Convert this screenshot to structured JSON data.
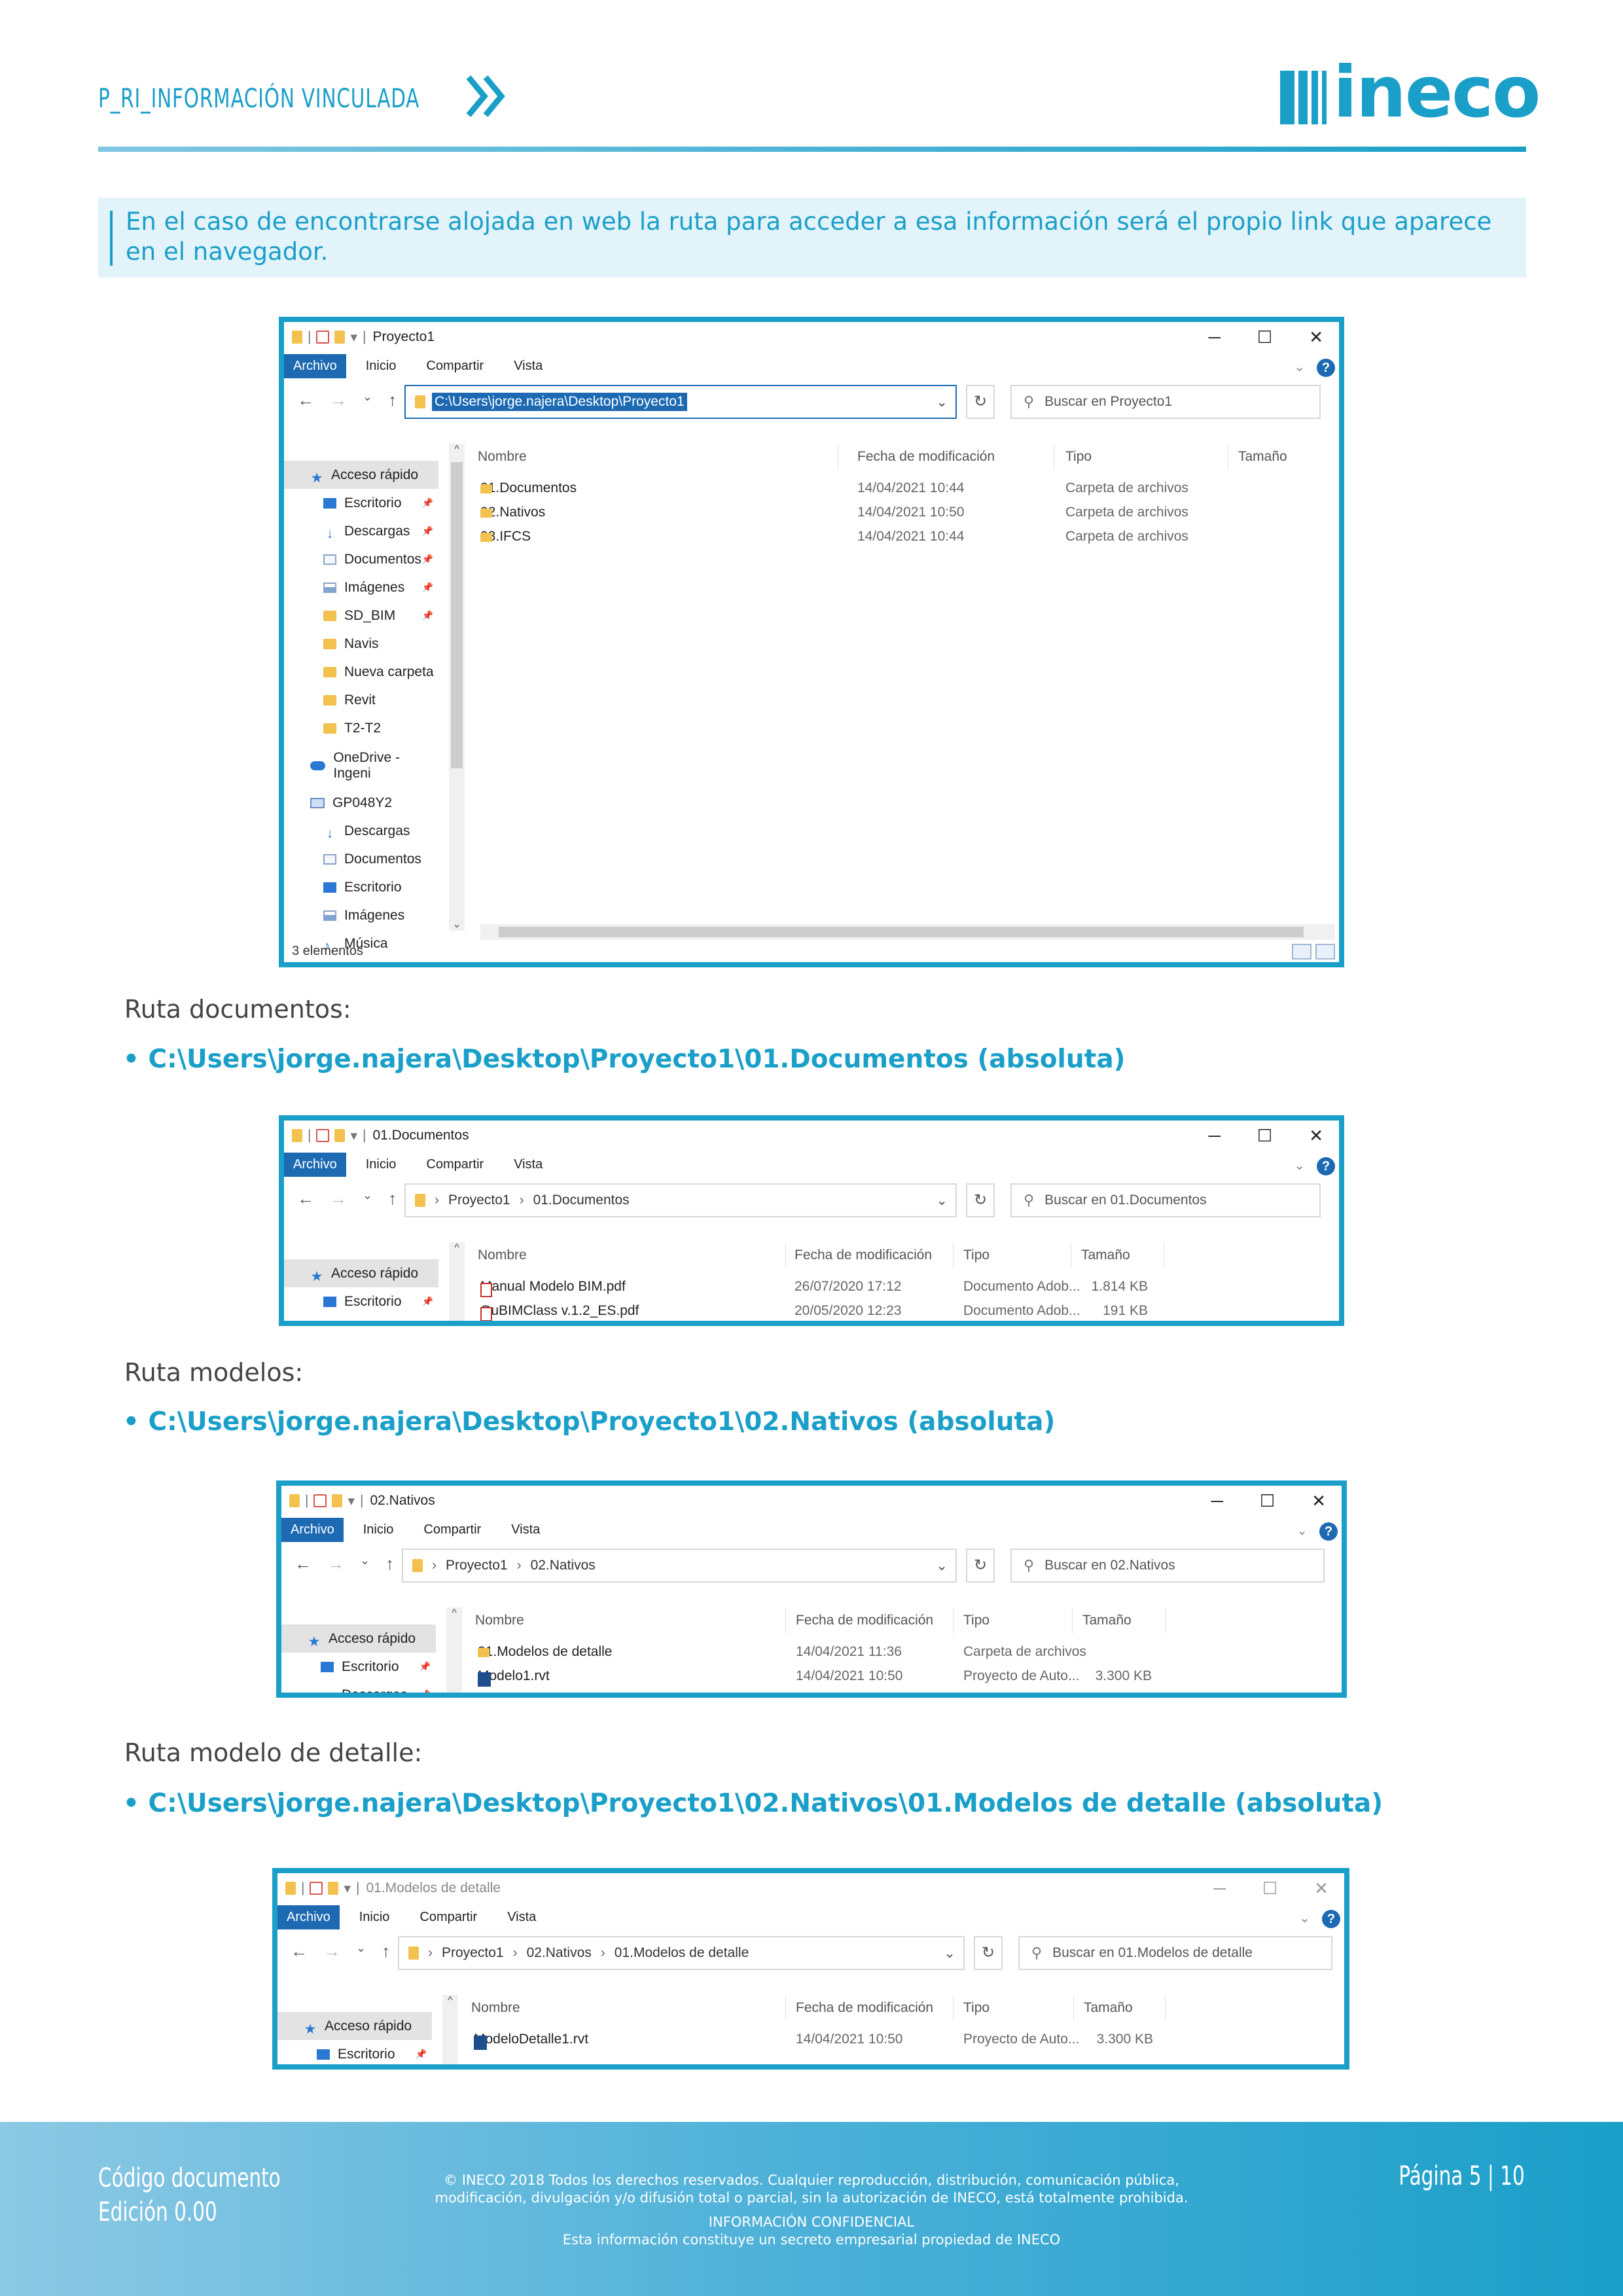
{
  "header": {
    "doc_title": "P_RI_INFORMACIÓN VINCULADA",
    "logo_text": "ineco",
    "brand_color": "#1a9fc9"
  },
  "intro": "En el caso de encontrarse alojada en web la ruta para acceder a esa información será el propio link que aparece en el navegador.",
  "sections": [
    {
      "label": "Ruta documentos:",
      "path": "• C:\\Users\\jorge.najera\\Desktop\\Proyecto1\\01.Documentos (absoluta)"
    },
    {
      "label": "Ruta modelos:",
      "path": "• C:\\Users\\jorge.najera\\Desktop\\Proyecto1\\02.Nativos (absoluta)"
    },
    {
      "label": "Ruta modelo de detalle:",
      "path": "• C:\\Users\\jorge.najera\\Desktop\\Proyecto1\\02.Nativos\\01.Modelos de detalle (absoluta)"
    }
  ],
  "explorer_common": {
    "ribbon": [
      "Archivo",
      "Inicio",
      "Compartir",
      "Vista"
    ],
    "columns": [
      "Nombre",
      "Fecha de modificación",
      "Tipo",
      "Tamaño"
    ],
    "window_controls": [
      "─",
      "☐",
      "✕"
    ],
    "help": "?"
  },
  "win1": {
    "title": "Proyecto1",
    "address": "C:\\Users\\jorge.najera\\Desktop\\Proyecto1",
    "search": "Buscar en Proyecto1",
    "sidebar": [
      {
        "label": "Acceso rápido",
        "icon": "star-icon"
      },
      {
        "label": "Escritorio",
        "icon": "desktop-icon",
        "pinned": true
      },
      {
        "label": "Descargas",
        "icon": "download-icon",
        "pinned": true
      },
      {
        "label": "Documentos",
        "icon": "document-icon",
        "pinned": true
      },
      {
        "label": "Imágenes",
        "icon": "images-icon",
        "pinned": true
      },
      {
        "label": "SD_BIM",
        "icon": "folder-icon",
        "pinned": true
      },
      {
        "label": "Navis",
        "icon": "folder-icon"
      },
      {
        "label": "Nueva carpeta",
        "icon": "folder-icon"
      },
      {
        "label": "Revit",
        "icon": "folder-icon"
      },
      {
        "label": "T2-T2",
        "icon": "folder-icon"
      },
      {
        "label": "OneDrive - Ingeni",
        "icon": "cloud-icon"
      },
      {
        "label": "GP048Y2",
        "icon": "computer-icon"
      },
      {
        "label": "Descargas",
        "icon": "download-icon"
      },
      {
        "label": "Documentos",
        "icon": "document-icon"
      },
      {
        "label": "Escritorio",
        "icon": "desktop-icon"
      },
      {
        "label": "Imágenes",
        "icon": "images-icon"
      },
      {
        "label": "Música",
        "icon": "music-icon"
      }
    ],
    "files": [
      {
        "name": "01.Documentos",
        "date": "14/04/2021 10:44",
        "type": "Carpeta de archivos",
        "size": ""
      },
      {
        "name": "02.Nativos",
        "date": "14/04/2021 10:50",
        "type": "Carpeta de archivos",
        "size": ""
      },
      {
        "name": "03.IFCS",
        "date": "14/04/2021 10:44",
        "type": "Carpeta de archivos",
        "size": ""
      }
    ],
    "status": "3 elementos"
  },
  "win2": {
    "title": "01.Documentos",
    "crumbs": [
      "Proyecto1",
      "01.Documentos"
    ],
    "search": "Buscar en 01.Documentos",
    "sidebar": [
      {
        "label": "Acceso rápido",
        "icon": "star-icon"
      },
      {
        "label": "Escritorio",
        "icon": "desktop-icon",
        "pinned": true
      }
    ],
    "files": [
      {
        "name": "Manual Modelo BIM.pdf",
        "date": "26/07/2020 17:12",
        "type": "Documento Adob...",
        "size": "1.814 KB"
      },
      {
        "name": "GuBIMClass v.1.2_ES.pdf",
        "date": "20/05/2020 12:23",
        "type": "Documento Adob...",
        "size": "191 KB"
      }
    ]
  },
  "win3": {
    "title": "02.Nativos",
    "crumbs": [
      "Proyecto1",
      "02.Nativos"
    ],
    "search": "Buscar en 02.Nativos",
    "sidebar": [
      {
        "label": "Acceso rápido",
        "icon": "star-icon"
      },
      {
        "label": "Escritorio",
        "icon": "desktop-icon",
        "pinned": true
      },
      {
        "label": "Descargas",
        "icon": "download-icon",
        "pinned": true
      }
    ],
    "files": [
      {
        "name": "01.Modelos de detalle",
        "date": "14/04/2021 11:36",
        "type": "Carpeta de archivos",
        "size": ""
      },
      {
        "name": "Modelo1.rvt",
        "date": "14/04/2021 10:50",
        "type": "Proyecto de Auto...",
        "size": "3.300 KB"
      }
    ]
  },
  "win4": {
    "title": "01.Modelos de detalle",
    "crumbs": [
      "Proyecto1",
      "02.Nativos",
      "01.Modelos de detalle"
    ],
    "search": "Buscar en 01.Modelos de detalle",
    "sidebar": [
      {
        "label": "Acceso rápido",
        "icon": "star-icon"
      },
      {
        "label": "Escritorio",
        "icon": "desktop-icon",
        "pinned": true
      }
    ],
    "files": [
      {
        "name": "ModeloDetalle1.rvt",
        "date": "14/04/2021 10:50",
        "type": "Proyecto de Auto...",
        "size": "3.300 KB"
      }
    ]
  },
  "footer": {
    "code": "Código documento",
    "edition": "Edición 0.00",
    "copyright": "© INECO 2018 Todos los derechos reservados. Cualquier reproducción, distribución, comunicación pública, modificación, divulgación y/o difusión total o parcial, sin la autorización de INECO, está totalmente prohibida.",
    "confidential": "INFORMACIÓN CONFIDENCIAL",
    "secret": "Esta información constituye un secreto empresarial propiedad de INECO",
    "page": "Página  5 | 10"
  }
}
